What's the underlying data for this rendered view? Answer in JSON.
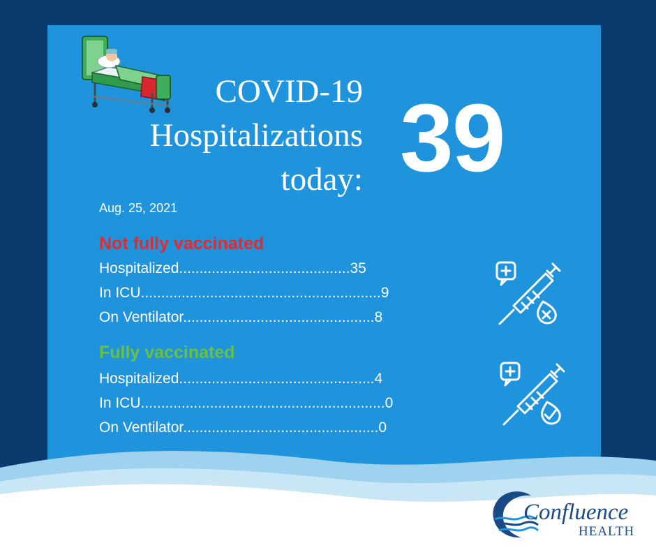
{
  "title_lines": [
    "COVID-19",
    "Hospitalizations",
    "today:"
  ],
  "total_hospitalized": "39",
  "date": "Aug. 25, 2021",
  "not_vaccinated": {
    "heading": "Not fully vaccinated",
    "color": "#e42a2a",
    "rows": [
      {
        "label": "Hospitalized",
        "dots": "..........................................",
        "value": "35"
      },
      {
        "label": "In ICU",
        "dots": "...........................................................",
        "value": "9"
      },
      {
        "label": "On Ventilator",
        "dots": "...............................................",
        "value": "8"
      }
    ]
  },
  "vaccinated": {
    "heading": "Fully vaccinated",
    "color": "#6bc13f",
    "rows": [
      {
        "label": "Hospitalized",
        "dots": "................................................",
        "value": "4"
      },
      {
        "label": "In ICU",
        "dots": "............................................................",
        "value": "0"
      },
      {
        "label": "On Ventilator",
        "dots": "................................................",
        "value": "0"
      }
    ]
  },
  "logo": {
    "name": "Confluence",
    "sub": "HEALTH"
  },
  "icons": {
    "bed": "hospital-bed-icon",
    "unvaccinated": "syringe-cross-icon",
    "vaccinated": "syringe-check-icon"
  },
  "colors": {
    "background": "#0b3a6e",
    "panel": "#1f93dc",
    "text": "#ffffff",
    "logo": "#1a4a86"
  }
}
